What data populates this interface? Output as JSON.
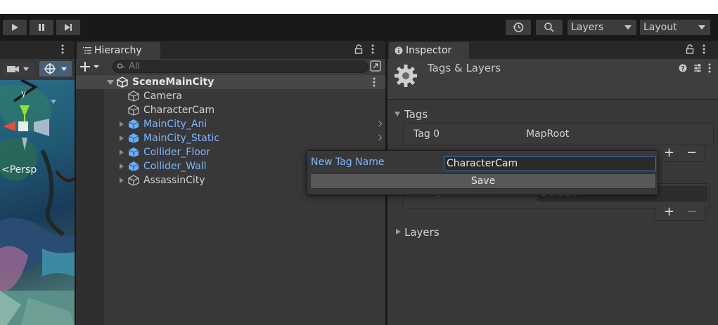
{
  "toolbar": {
    "play_icon": "play-icon",
    "pause_icon": "pause-icon",
    "step_icon": "step-icon",
    "history_icon": "history-icon",
    "search_icon": "search-icon",
    "layers_dropdown": "Layers",
    "layout_dropdown": "Layout"
  },
  "scene": {
    "persp_label": "<Persp",
    "axis_y": "y"
  },
  "hierarchy": {
    "tab_label": "Hierarchy",
    "search_placeholder": "All",
    "scene_name": "SceneMainCity",
    "items": [
      {
        "label": "Camera",
        "foldable": false,
        "prefab": false
      },
      {
        "label": "CharacterCam",
        "foldable": false,
        "prefab": false
      },
      {
        "label": "MainCity_Ani",
        "foldable": true,
        "prefab": true
      },
      {
        "label": "MainCity_Static",
        "foldable": true,
        "prefab": true
      },
      {
        "label": "Collider_Floor",
        "foldable": true,
        "prefab": true
      },
      {
        "label": "Collider_Wall",
        "foldable": true,
        "prefab": true
      },
      {
        "label": "AssassinCity",
        "foldable": true,
        "prefab": false
      }
    ]
  },
  "inspector": {
    "tab_label": "Inspector",
    "title": "Tags & Layers",
    "tags_section": "Tags",
    "tag0_label": "Tag 0",
    "tag0_value": "MapRoot",
    "sorting_hidden_label": "y",
    "sorting_hidden_value": "Default",
    "layers_section": "Layers",
    "plus": "+",
    "minus": "−"
  },
  "popup": {
    "label": "New Tag Name",
    "input_value": "CharacterCam",
    "save_label": "Save"
  },
  "colors": {
    "accent_blue": "#7fb6ff",
    "input_focus": "#3a79bb"
  }
}
